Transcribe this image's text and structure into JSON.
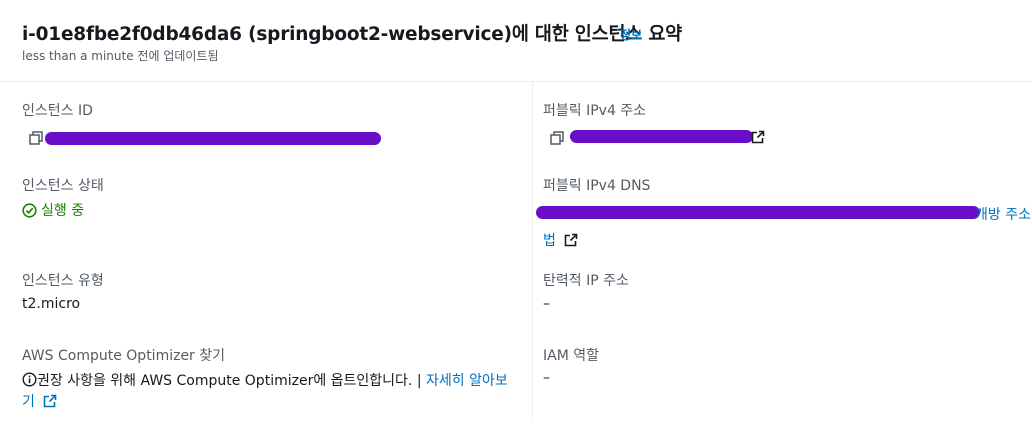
{
  "header": {
    "title": "i-01e8fbe2f0db46da6 (springboot2-webservice)에 대한 인스턴스 요약",
    "info_link": "정보",
    "updated": "less than a minute 전에 업데이트됨"
  },
  "left": {
    "instance_id_label": "인스턴스 ID",
    "state_label": "인스턴스 상태",
    "state_value": "실행 중",
    "type_label": "인스턴스 유형",
    "type_value": "t2.micro",
    "optimizer_label": "AWS Compute Optimizer 찾기",
    "optimizer_text": "권장 사항을 위해 AWS Compute Optimizer에 옵트인합니다. |",
    "learn_more_1": "자세히 알아보",
    "learn_more_2": "기"
  },
  "right": {
    "public_ipv4_label": "퍼블릭 IPv4 주소",
    "public_dns_label": "퍼블릭 IPv4 DNS",
    "dns_suffix": "개방 주소",
    "dns_suffix_2": "법",
    "elastic_ip_label": "탄력적 IP 주소",
    "elastic_ip_value": "–",
    "iam_role_label": "IAM 역할",
    "iam_role_value": "–"
  },
  "colors": {
    "link": "#0073bb",
    "success": "#1d8102",
    "redaction": "#6a0dc9"
  },
  "icons": [
    "copy-icon",
    "external-link-icon",
    "status-check-icon",
    "info-icon"
  ]
}
